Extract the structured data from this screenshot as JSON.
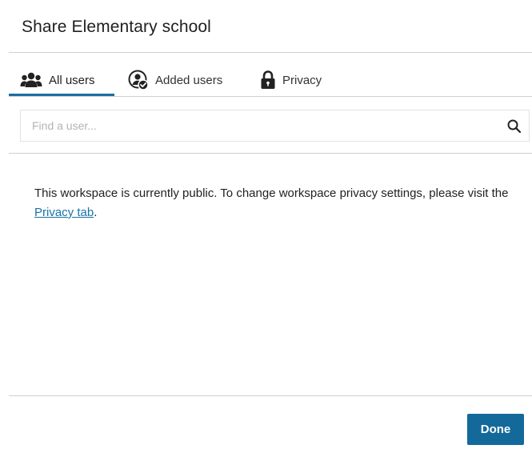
{
  "dialog": {
    "title": "Share Elementary school"
  },
  "tabs": [
    {
      "label": "All users",
      "icon": "users-group-icon",
      "active": true
    },
    {
      "label": "Added users",
      "icon": "user-check-icon",
      "active": false
    },
    {
      "label": "Privacy",
      "icon": "lock-icon",
      "active": false
    }
  ],
  "search": {
    "placeholder": "Find a user...",
    "value": "",
    "icon": "search-icon"
  },
  "message": {
    "text_before": "This workspace is currently public. To change workspace privacy settings, please visit the ",
    "link_text": "Privacy tab",
    "text_after": "."
  },
  "footer": {
    "done_label": "Done"
  },
  "colors": {
    "accent": "#136a9a",
    "link": "#1a73a8",
    "divider": "#cfcfcf"
  }
}
